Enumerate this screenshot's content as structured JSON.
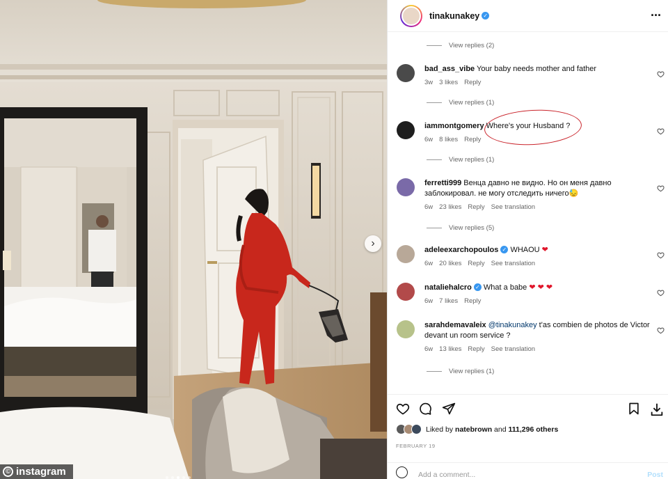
{
  "photo": {
    "watermark": "instagram",
    "watermark_symbol": "©",
    "next_arrow": "›",
    "carousel_slides": 5,
    "carousel_active": 3
  },
  "post": {
    "username": "tinakunakey",
    "verified": true,
    "more_icon": "···"
  },
  "comments": [
    {
      "type": "view-replies",
      "label": "View replies (2)"
    },
    {
      "type": "comment",
      "user": "bad_ass_vibe",
      "text": "Your baby needs mother and father",
      "age": "3w",
      "likes": "3 likes",
      "reply": "Reply",
      "avatar_color": "#4a4a4a"
    },
    {
      "type": "view-replies",
      "label": "View replies (1)"
    },
    {
      "type": "comment",
      "user": "iammontgomery",
      "text": "Where's your Husband ?",
      "age": "6w",
      "likes": "8 likes",
      "reply": "Reply",
      "avatar_color": "#1e1e1e"
    },
    {
      "type": "view-replies",
      "label": "View replies (1)"
    },
    {
      "type": "comment",
      "user": "ferretti999",
      "text": "Венца давно не видно. Но он меня давно заблокировал. не могу отследить ничего",
      "emoji": "😓",
      "age": "6w",
      "likes": "23 likes",
      "reply": "Reply",
      "translate": "See translation",
      "avatar_color": "#7a6aa8"
    },
    {
      "type": "view-replies",
      "label": "View replies (5)"
    },
    {
      "type": "comment",
      "user": "adeleexarchopoulos",
      "verified": true,
      "text": "WHAOU",
      "hearts": 1,
      "age": "6w",
      "likes": "20 likes",
      "reply": "Reply",
      "translate": "See translation",
      "avatar_color": "#b8a898"
    },
    {
      "type": "comment",
      "user": "nataliehalcro",
      "verified": true,
      "text": "What a babe",
      "hearts": 3,
      "age": "6w",
      "likes": "7 likes",
      "reply": "Reply",
      "avatar_color": "#b24a4a"
    },
    {
      "type": "comment",
      "user": "sarahdemavaleix",
      "mention": "@tinakunakey",
      "text": "t'as combien de photos de Victor devant un room service ?",
      "age": "6w",
      "likes": "13 likes",
      "reply": "Reply",
      "translate": "See translation",
      "avatar_color": "#b7c28a"
    },
    {
      "type": "view-replies",
      "label": "View replies (1)"
    }
  ],
  "likes": {
    "prefix": "Liked by",
    "user": "natebrown",
    "middle": "and",
    "count": "111,296 others"
  },
  "date": "FEBRUARY 19",
  "add_comment": {
    "placeholder": "Add a comment...",
    "post_label": "Post"
  },
  "colors": {
    "verified": "#3897f0",
    "heart": "#e0162b",
    "annotation_circle": "#c9232a",
    "dress": "#c8271c"
  }
}
